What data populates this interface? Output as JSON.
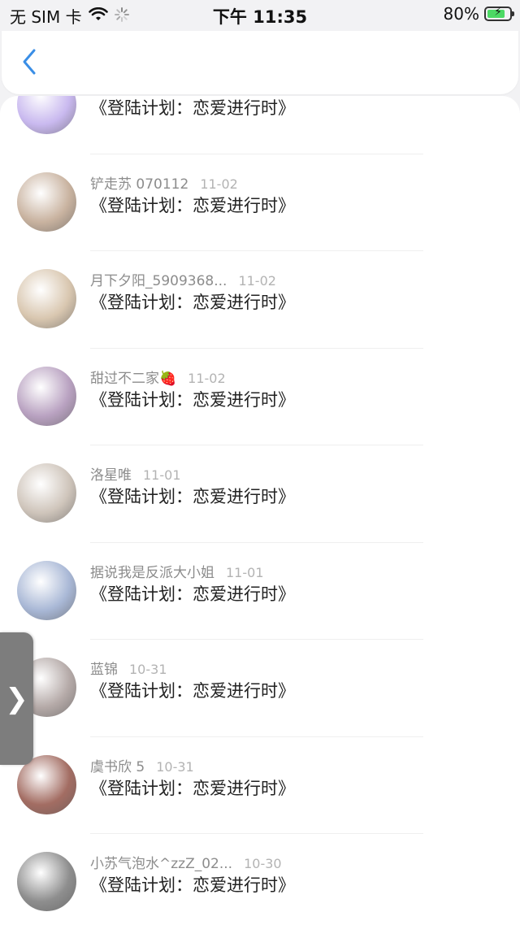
{
  "status_bar": {
    "carrier": "无 SIM 卡",
    "time": "下午 11:35",
    "battery": "80%",
    "battery_level": 0.8
  },
  "nav": {
    "back_icon": "chevron-left-icon"
  },
  "list": {
    "items": [
      {
        "user": "",
        "date": "",
        "title": "《登陆计划：恋爱进行时》",
        "avatar_color": "#c9b9ef"
      },
      {
        "user": "铲走苏 070112",
        "date": "11-02",
        "title": "《登陆计划：恋爱进行时》",
        "avatar_color": "#c9b3a0"
      },
      {
        "user": "月下夕阳_5909368...",
        "date": "11-02",
        "title": "《登陆计划：恋爱进行时》",
        "avatar_color": "#d9c7b0"
      },
      {
        "user": "甜过不二家🍓",
        "date": "11-02",
        "title": "《登陆计划：恋爱进行时》",
        "avatar_color": "#b9a2c1"
      },
      {
        "user": "洛星唯",
        "date": "11-01",
        "title": "《登陆计划：恋爱进行时》",
        "avatar_color": "#cfc5bb"
      },
      {
        "user": "据说我是反派大小姐",
        "date": "11-01",
        "title": "《登陆计划：恋爱进行时》",
        "avatar_color": "#a9b8d6"
      },
      {
        "user": "蓝锦",
        "date": "10-31",
        "title": "《登陆计划：恋爱进行时》",
        "avatar_color": "#b5aaa8"
      },
      {
        "user": "虞书欣 5",
        "date": "10-31",
        "title": "《登陆计划：恋爱进行时》",
        "avatar_color": "#a36d63"
      },
      {
        "user": "小苏气泡水^zzZ_02...",
        "date": "10-30",
        "title": "《登陆计划：恋爱进行时》",
        "avatar_color": "#8e8e8e"
      }
    ]
  },
  "drawer": {
    "label": "❯"
  }
}
